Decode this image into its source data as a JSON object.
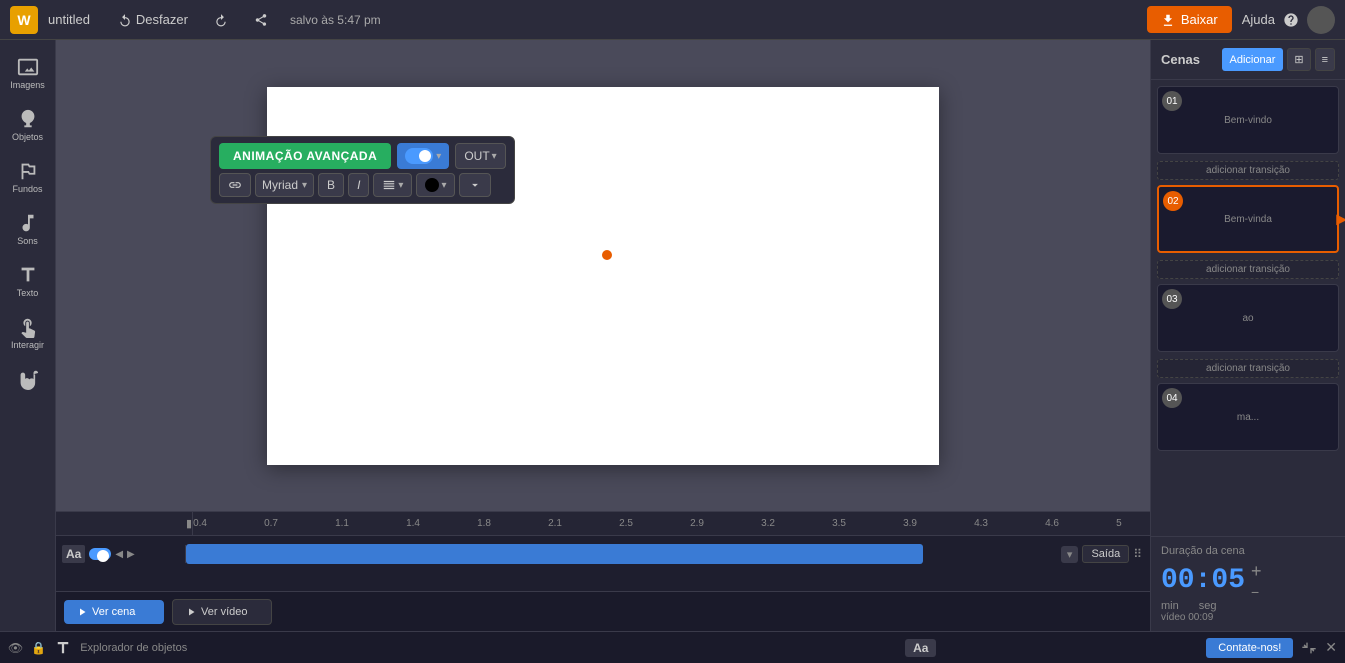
{
  "topbar": {
    "logo": "W",
    "title": "untitled",
    "undo_label": "Desfazer",
    "redo_label": "",
    "share_label": "",
    "save_label": "salvo às 5:47 pm",
    "download_label": "Baixar",
    "help_label": "Ajuda"
  },
  "sidebar": {
    "items": [
      {
        "id": "images",
        "label": "Imagens",
        "icon": "camera"
      },
      {
        "id": "objects",
        "label": "Objetos",
        "icon": "person"
      },
      {
        "id": "backgrounds",
        "label": "Fundos",
        "icon": "mountain"
      },
      {
        "id": "sounds",
        "label": "Sons",
        "icon": "music"
      },
      {
        "id": "text",
        "label": "Texto",
        "icon": "text"
      },
      {
        "id": "interact",
        "label": "Interagir",
        "icon": "interact"
      },
      {
        "id": "hand",
        "label": "",
        "icon": "hand"
      }
    ]
  },
  "toolbar": {
    "animation_btn": "ANIMAÇÃO AVANÇADA",
    "toggle_label": "",
    "out_label": "OUT",
    "font_name": "Myriad",
    "bold_label": "B",
    "italic_label": "I"
  },
  "scenes": {
    "title": "Cenas",
    "add_label": "Adicionar",
    "add_transition_label": "adicionar transição",
    "items": [
      {
        "num": "01",
        "text": "Bem-vindo",
        "active": false
      },
      {
        "num": "02",
        "text": "Bem-vinda",
        "active": true
      },
      {
        "num": "03",
        "text": "ao",
        "active": false
      },
      {
        "num": "04",
        "text": "ma...",
        "active": false
      }
    ]
  },
  "duration": {
    "label": "Duração da cena",
    "time": "00:05",
    "min_label": "min",
    "seg_label": "seg",
    "video_label": "vídeo 00:09"
  },
  "timeline": {
    "markers": [
      "0.4",
      "0.7",
      "1.1",
      "1.4",
      "1.8",
      "2.1",
      "2.5",
      "2.9",
      "3.2",
      "3.5",
      "3.9",
      "4.3",
      "4.6",
      "5"
    ],
    "end_label": "Saída"
  },
  "bottom": {
    "ver_cena_label": "Ver cena",
    "ver_video_label": "Ver vídeo"
  },
  "statusbar": {
    "explorer_label": "Explorador de objetos",
    "contact_label": "Contate-nos!"
  }
}
